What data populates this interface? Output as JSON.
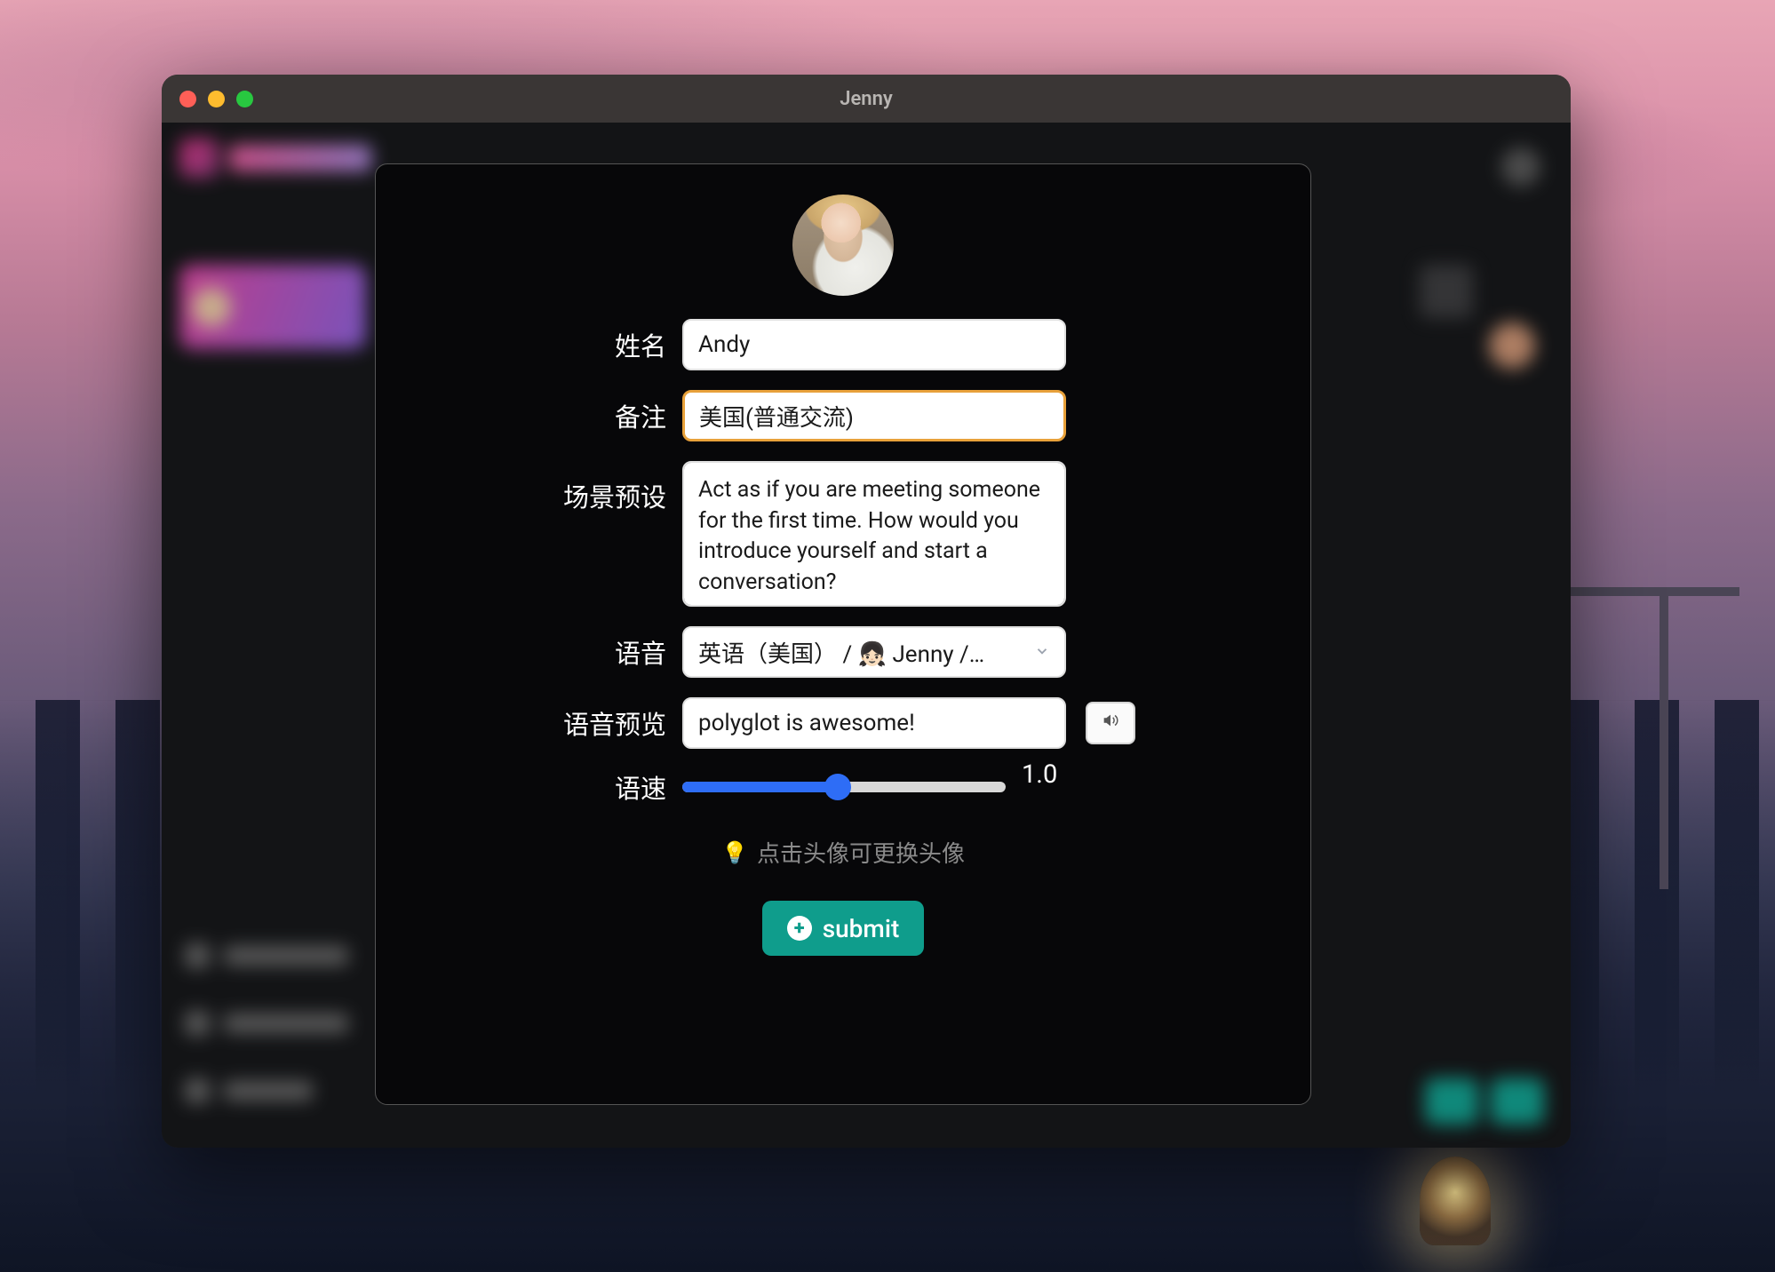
{
  "window": {
    "title": "Jenny"
  },
  "form": {
    "labels": {
      "name": "姓名",
      "remark": "备注",
      "preset": "场景预设",
      "voice": "语音",
      "preview": "语音预览",
      "speed": "语速"
    },
    "values": {
      "name": "Andy",
      "remark": "美国(普通交流)",
      "preset": "Act as if you are meeting someone for the first time. How would you introduce yourself and start a conversation?",
      "voice": "英语（美国） / 👧🏻 Jenny /…",
      "preview": "polyglot is awesome!",
      "speed_display": "1.0"
    },
    "hint": "点击头像可更换头像",
    "submit_label": "submit"
  },
  "colors": {
    "accent": "#0f9d8c",
    "focus_ring": "#e8a13a",
    "slider": "#2e6df6"
  }
}
